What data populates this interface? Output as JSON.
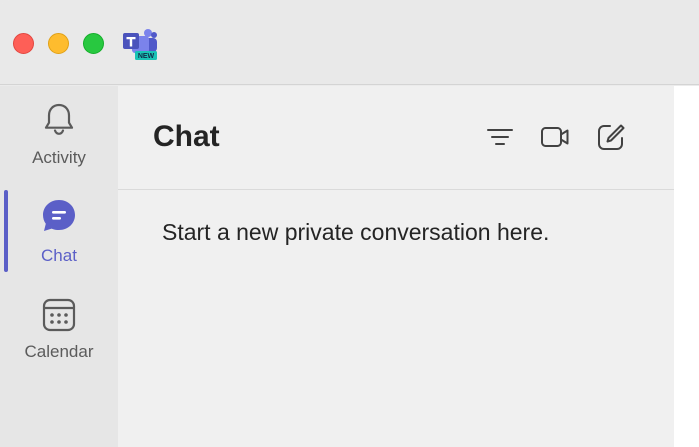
{
  "app": {
    "logo_icon": "teams-logo-icon",
    "logo_badge": "NEW"
  },
  "window_controls": [
    "close",
    "minimize",
    "zoom"
  ],
  "rail": {
    "items": [
      {
        "label": "Activity",
        "icon": "bell-icon",
        "active": false
      },
      {
        "label": "Chat",
        "icon": "chat-bubble-icon",
        "active": true
      },
      {
        "label": "Calendar",
        "icon": "calendar-icon",
        "active": false
      }
    ]
  },
  "chat_pane": {
    "title": "Chat",
    "actions": [
      {
        "icon": "filter-icon"
      },
      {
        "icon": "video-call-icon"
      },
      {
        "icon": "new-chat-icon"
      }
    ],
    "empty_message": "Start a new private conversation here."
  },
  "colors": {
    "accent": "#5b5fc7",
    "close": "#fe5f57",
    "minimize": "#febc2e",
    "zoom": "#28c840"
  }
}
